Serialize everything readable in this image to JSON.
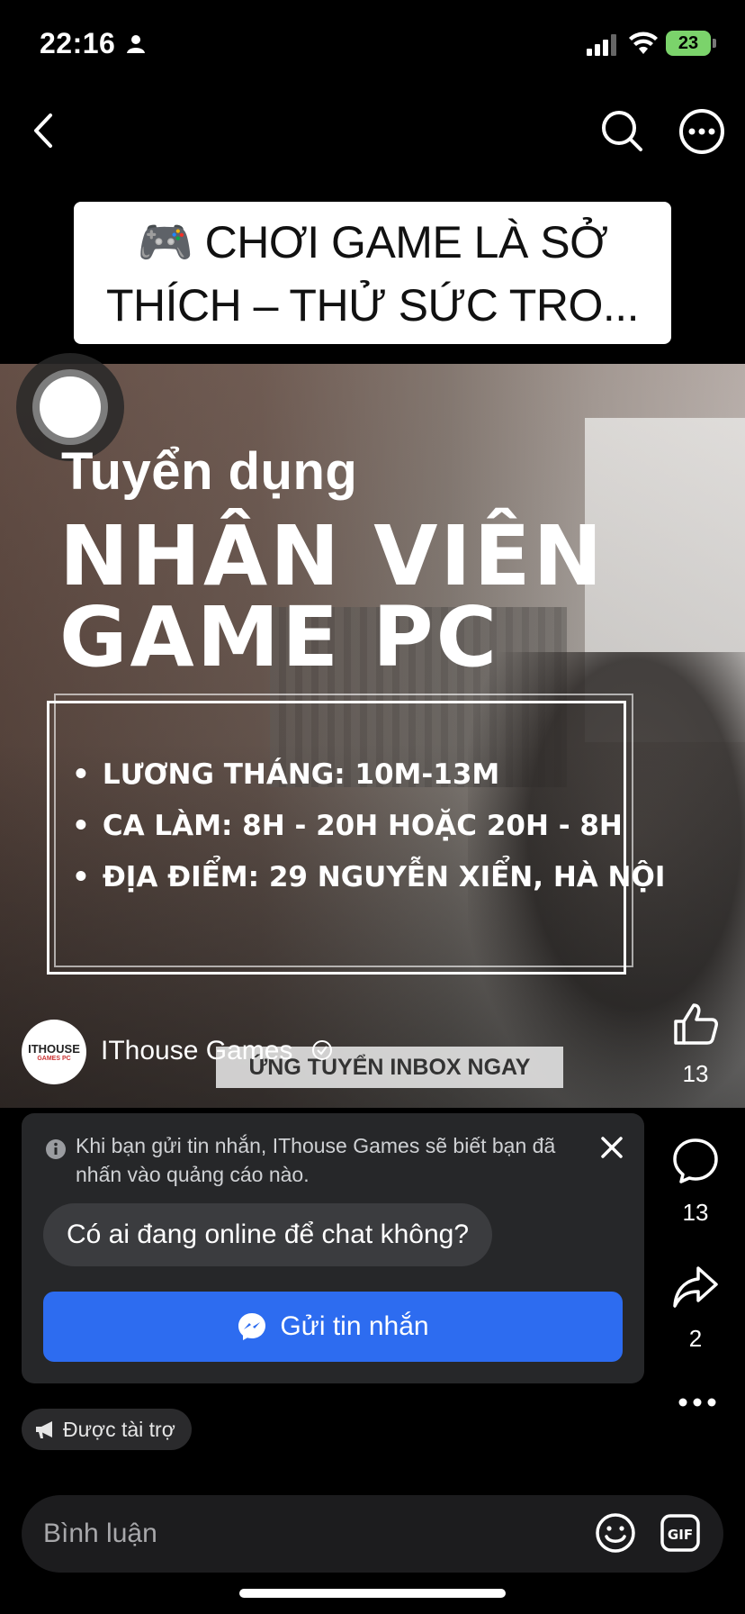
{
  "status_bar": {
    "time": "22:16",
    "battery": "23"
  },
  "caption": {
    "line1": "🎮 CHƠI GAME LÀ SỞ",
    "line2": "THÍCH – THỬ SỨC TRO..."
  },
  "video": {
    "small_title": "Tuyển dụng",
    "big_title_1": "NHÂN VIÊN",
    "big_title_2": "GAME PC",
    "info_items": [
      "LƯƠNG THÁNG: 10M-13M",
      "CA LÀM: 8H - 20H HOẶC 20H - 8H",
      "ĐỊA ĐIỂM: 29 NGUYỄN XIỂN, HÀ NỘI"
    ],
    "banner": "ỨNG TUYỂN INBOX NGAY",
    "avatar_text": "ITHOUSE",
    "avatar_subtext": "GAMES PC",
    "page_name": "IThouse Games"
  },
  "rail": {
    "likes": "13",
    "comments": "13",
    "shares": "2"
  },
  "message_card": {
    "notice": "Khi bạn gửi tin nhắn, IThouse Games sẽ biết bạn đã nhấn vào quảng cáo nào.",
    "quick_reply": "Có ai đang online để chat không?",
    "send_label": "Gửi tin nhắn"
  },
  "sponsored": "Được tài trợ",
  "comment_bar": {
    "placeholder": "Bình luận"
  },
  "colors": {
    "accent": "#2d6cf0",
    "battery": "#7bd36b"
  }
}
